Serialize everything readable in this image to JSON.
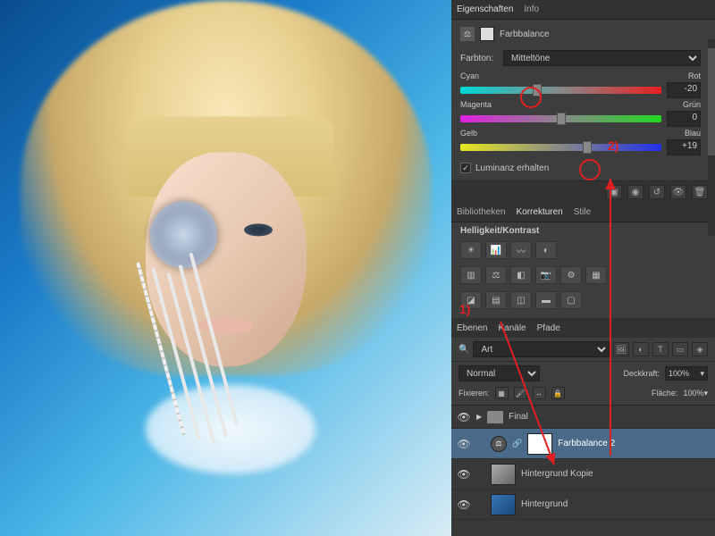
{
  "properties": {
    "tabs": {
      "props": "Eigenschaften",
      "info": "Info"
    },
    "adj_name": "Farbbalance",
    "tone_label": "Farbton:",
    "tone_value": "Mitteltöne",
    "sliders": {
      "cyan": {
        "left": "Cyan",
        "right": "Rot",
        "value": "-20",
        "pos": 38
      },
      "magenta": {
        "left": "Magenta",
        "right": "Grün",
        "value": "0",
        "pos": 50
      },
      "yellow": {
        "left": "Gelb",
        "right": "Blau",
        "value": "+19",
        "pos": 63
      }
    },
    "preserve_lum": "Luminanz erhalten"
  },
  "adjustments": {
    "tabs": {
      "lib": "Bibliotheken",
      "corr": "Korrekturen",
      "styles": "Stile"
    },
    "subtitle": "Helligkeit/Kontrast"
  },
  "layers_panel": {
    "tabs": {
      "layers": "Ebenen",
      "channels": "Kanäle",
      "paths": "Pfade"
    },
    "filter": "Art",
    "blend_mode": "Normal",
    "opacity_label": "Deckkraft:",
    "opacity_value": "100%",
    "lock_label": "Fixieren:",
    "fill_label": "Fläche:",
    "fill_value": "100%",
    "layers": [
      {
        "name": "Final",
        "type": "group"
      },
      {
        "name": "Farbbalance 2",
        "type": "adj",
        "selected": true
      },
      {
        "name": "Hintergrund Kopie",
        "type": "img1"
      },
      {
        "name": "Hintergrund",
        "type": "img2"
      }
    ]
  },
  "annotations": {
    "a1": "1)",
    "a2": "2)"
  }
}
